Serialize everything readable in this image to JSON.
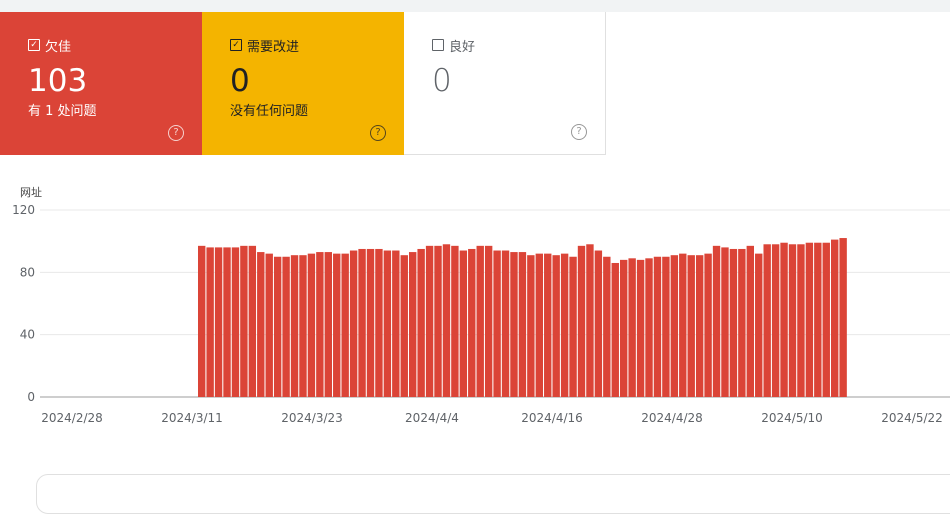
{
  "cards": {
    "poor": {
      "label": "欠佳",
      "count": "103",
      "subtitle": "有 1 处问题",
      "checked": true,
      "color": "#db4437"
    },
    "needs_improvement": {
      "label": "需要改进",
      "count": "0",
      "subtitle": "没有任何问题",
      "checked": true,
      "color": "#f4b400"
    },
    "good": {
      "label": "良好",
      "count": "0",
      "checked": false
    }
  },
  "help_glyph": "?",
  "chart_data": {
    "type": "bar",
    "ylabel": "网址",
    "ylim": [
      0,
      120
    ],
    "yticks": [
      0,
      40,
      80,
      120
    ],
    "xticks": [
      "2024/2/28",
      "2024/3/11",
      "2024/3/23",
      "2024/4/4",
      "2024/4/16",
      "2024/4/28",
      "2024/5/10",
      "2024/5/22"
    ],
    "bar_color": "#db4437",
    "series": [
      {
        "name": "欠佳",
        "values": [
          0,
          0,
          0,
          0,
          0,
          0,
          0,
          0,
          0,
          0,
          0,
          0,
          0,
          0,
          0,
          0,
          97,
          96,
          96,
          96,
          96,
          97,
          97,
          93,
          92,
          90,
          90,
          91,
          91,
          92,
          93,
          93,
          92,
          92,
          94,
          95,
          95,
          95,
          94,
          94,
          91,
          93,
          95,
          97,
          97,
          98,
          97,
          94,
          95,
          97,
          97,
          94,
          94,
          93,
          93,
          91,
          92,
          92,
          91,
          92,
          90,
          97,
          98,
          94,
          90,
          86,
          88,
          89,
          88,
          89,
          90,
          90,
          91,
          92,
          91,
          91,
          92,
          97,
          96,
          95,
          95,
          97,
          92,
          98,
          98,
          99,
          98,
          98,
          99,
          99,
          99,
          101,
          102
        ]
      }
    ]
  }
}
